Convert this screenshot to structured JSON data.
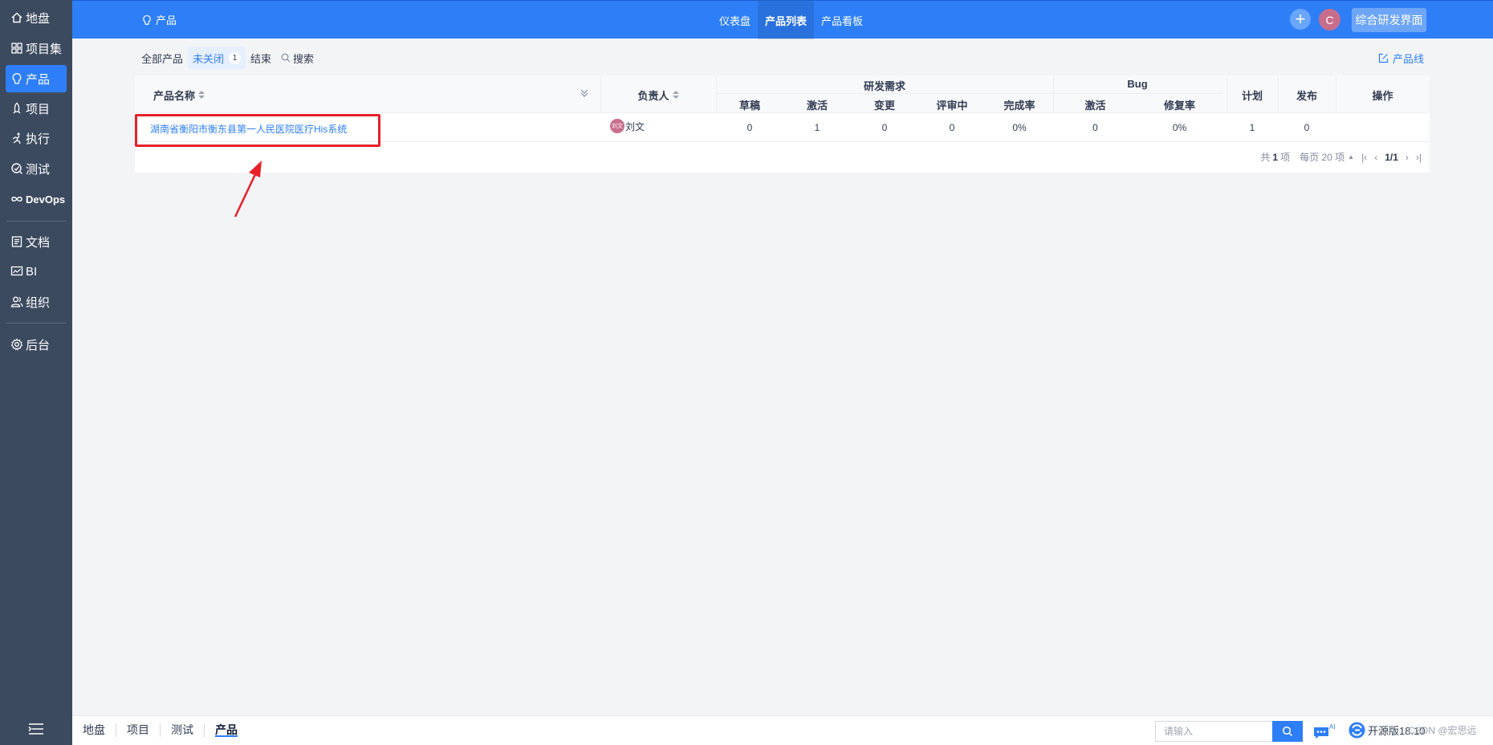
{
  "sidebar": {
    "items": [
      {
        "label": "地盘",
        "icon": "home-icon"
      },
      {
        "label": "项目集",
        "icon": "grid-icon"
      },
      {
        "label": "产品",
        "icon": "bulb-icon",
        "active": true
      },
      {
        "label": "项目",
        "icon": "rocket-icon"
      },
      {
        "label": "执行",
        "icon": "run-icon"
      },
      {
        "label": "测试",
        "icon": "test-icon"
      },
      {
        "label": "DevOps",
        "icon": "infinity-icon"
      },
      {
        "label": "文档",
        "icon": "doc-icon"
      },
      {
        "label": "BI",
        "icon": "chart-icon"
      },
      {
        "label": "组织",
        "icon": "users-icon"
      },
      {
        "label": "后台",
        "icon": "gear-icon"
      }
    ]
  },
  "header": {
    "crumb": "产品",
    "tabs": [
      {
        "label": "仪表盘"
      },
      {
        "label": "产品列表",
        "active": true
      },
      {
        "label": "产品看板"
      }
    ],
    "avatar_initial": "C",
    "switch_label": "综合研发界面"
  },
  "filter": {
    "all": "全部产品",
    "open": "未关闭",
    "open_count": "1",
    "closed": "结束",
    "search": "搜索",
    "productline": "产品线"
  },
  "table": {
    "headers": {
      "name": "产品名称",
      "owner": "负责人",
      "story_group": "研发需求",
      "story_cols": [
        "草稿",
        "激活",
        "变更",
        "评审中",
        "完成率"
      ],
      "bug_group": "Bug",
      "bug_cols": [
        "激活",
        "修复率"
      ],
      "plan": "计划",
      "release": "发布",
      "actions": "操作"
    },
    "rows": [
      {
        "name": "湖南省衡阳市衡东县第一人民医院医疗His系统",
        "owner_avatar": "刘文",
        "owner": "刘文",
        "story": [
          "0",
          "1",
          "0",
          "0",
          "0%"
        ],
        "bug": [
          "0",
          "0%"
        ],
        "plan": "1",
        "release": "0"
      }
    ],
    "pager": {
      "total_prefix": "共",
      "total": "1",
      "total_suffix": "项",
      "per_page": "每页 20 项",
      "page": "1/1"
    }
  },
  "bottombar": {
    "crumbs": [
      "地盘",
      "项目",
      "测试",
      "产品"
    ],
    "search_placeholder": "请输入",
    "version": "开源版18.10",
    "watermark": "CSDN @宏思远"
  },
  "colors": {
    "primary": "#2e7ff7",
    "sidebar": "#3c4a5f",
    "annotation": "#e8202a"
  }
}
